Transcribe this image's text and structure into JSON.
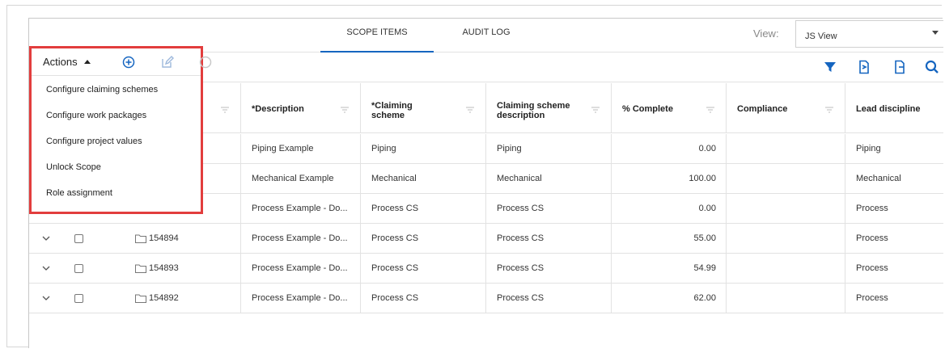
{
  "tabs": [
    {
      "label": "SCOPE ITEMS",
      "active": true
    },
    {
      "label": "AUDIT LOG",
      "active": false
    }
  ],
  "view": {
    "label": "View:",
    "value": "JS View"
  },
  "toolbar": {
    "actions_label": "Actions",
    "left_icons": [
      "plus-circle-icon",
      "edit-icon",
      "cancel-icon"
    ],
    "right_icons": [
      "filter-icon",
      "import-icon",
      "export-icon",
      "search-icon"
    ]
  },
  "actions_menu": {
    "items": [
      "Configure claiming schemes",
      "Configure work packages",
      "Configure project values",
      "Unlock Scope",
      "Role assignment"
    ]
  },
  "table": {
    "columns": [
      {
        "label": "*Description"
      },
      {
        "label": "*Claiming\nscheme"
      },
      {
        "label": "Claiming scheme\ndescription"
      },
      {
        "label": "% Complete"
      },
      {
        "label": "Compliance"
      },
      {
        "label": "Lead discipline"
      }
    ],
    "rows": [
      {
        "id": "",
        "description": "Piping Example",
        "scheme": "Piping",
        "scheme_desc": "Piping",
        "complete": "0.00",
        "compliance": "",
        "lead": "Piping"
      },
      {
        "id": "",
        "description": "Mechanical Example",
        "scheme": "Mechanical",
        "scheme_desc": "Mechanical",
        "complete": "100.00",
        "compliance": "",
        "lead": "Mechanical"
      },
      {
        "id": "",
        "description": "Process Example - Do...",
        "scheme": "Process CS",
        "scheme_desc": "Process CS",
        "complete": "0.00",
        "compliance": "",
        "lead": "Process"
      },
      {
        "id": "154894",
        "description": "Process Example - Do...",
        "scheme": "Process CS",
        "scheme_desc": "Process CS",
        "complete": "55.00",
        "compliance": "",
        "lead": "Process"
      },
      {
        "id": "154893",
        "description": "Process Example - Do...",
        "scheme": "Process CS",
        "scheme_desc": "Process CS",
        "complete": "54.99",
        "compliance": "",
        "lead": "Process"
      },
      {
        "id": "154892",
        "description": "Process Example - Do...",
        "scheme": "Process CS",
        "scheme_desc": "Process CS",
        "complete": "62.00",
        "compliance": "",
        "lead": "Process"
      }
    ]
  },
  "colors": {
    "accent": "#1565c0",
    "highlight_border": "#e23d3d",
    "icon_blue": "#1565c0"
  }
}
